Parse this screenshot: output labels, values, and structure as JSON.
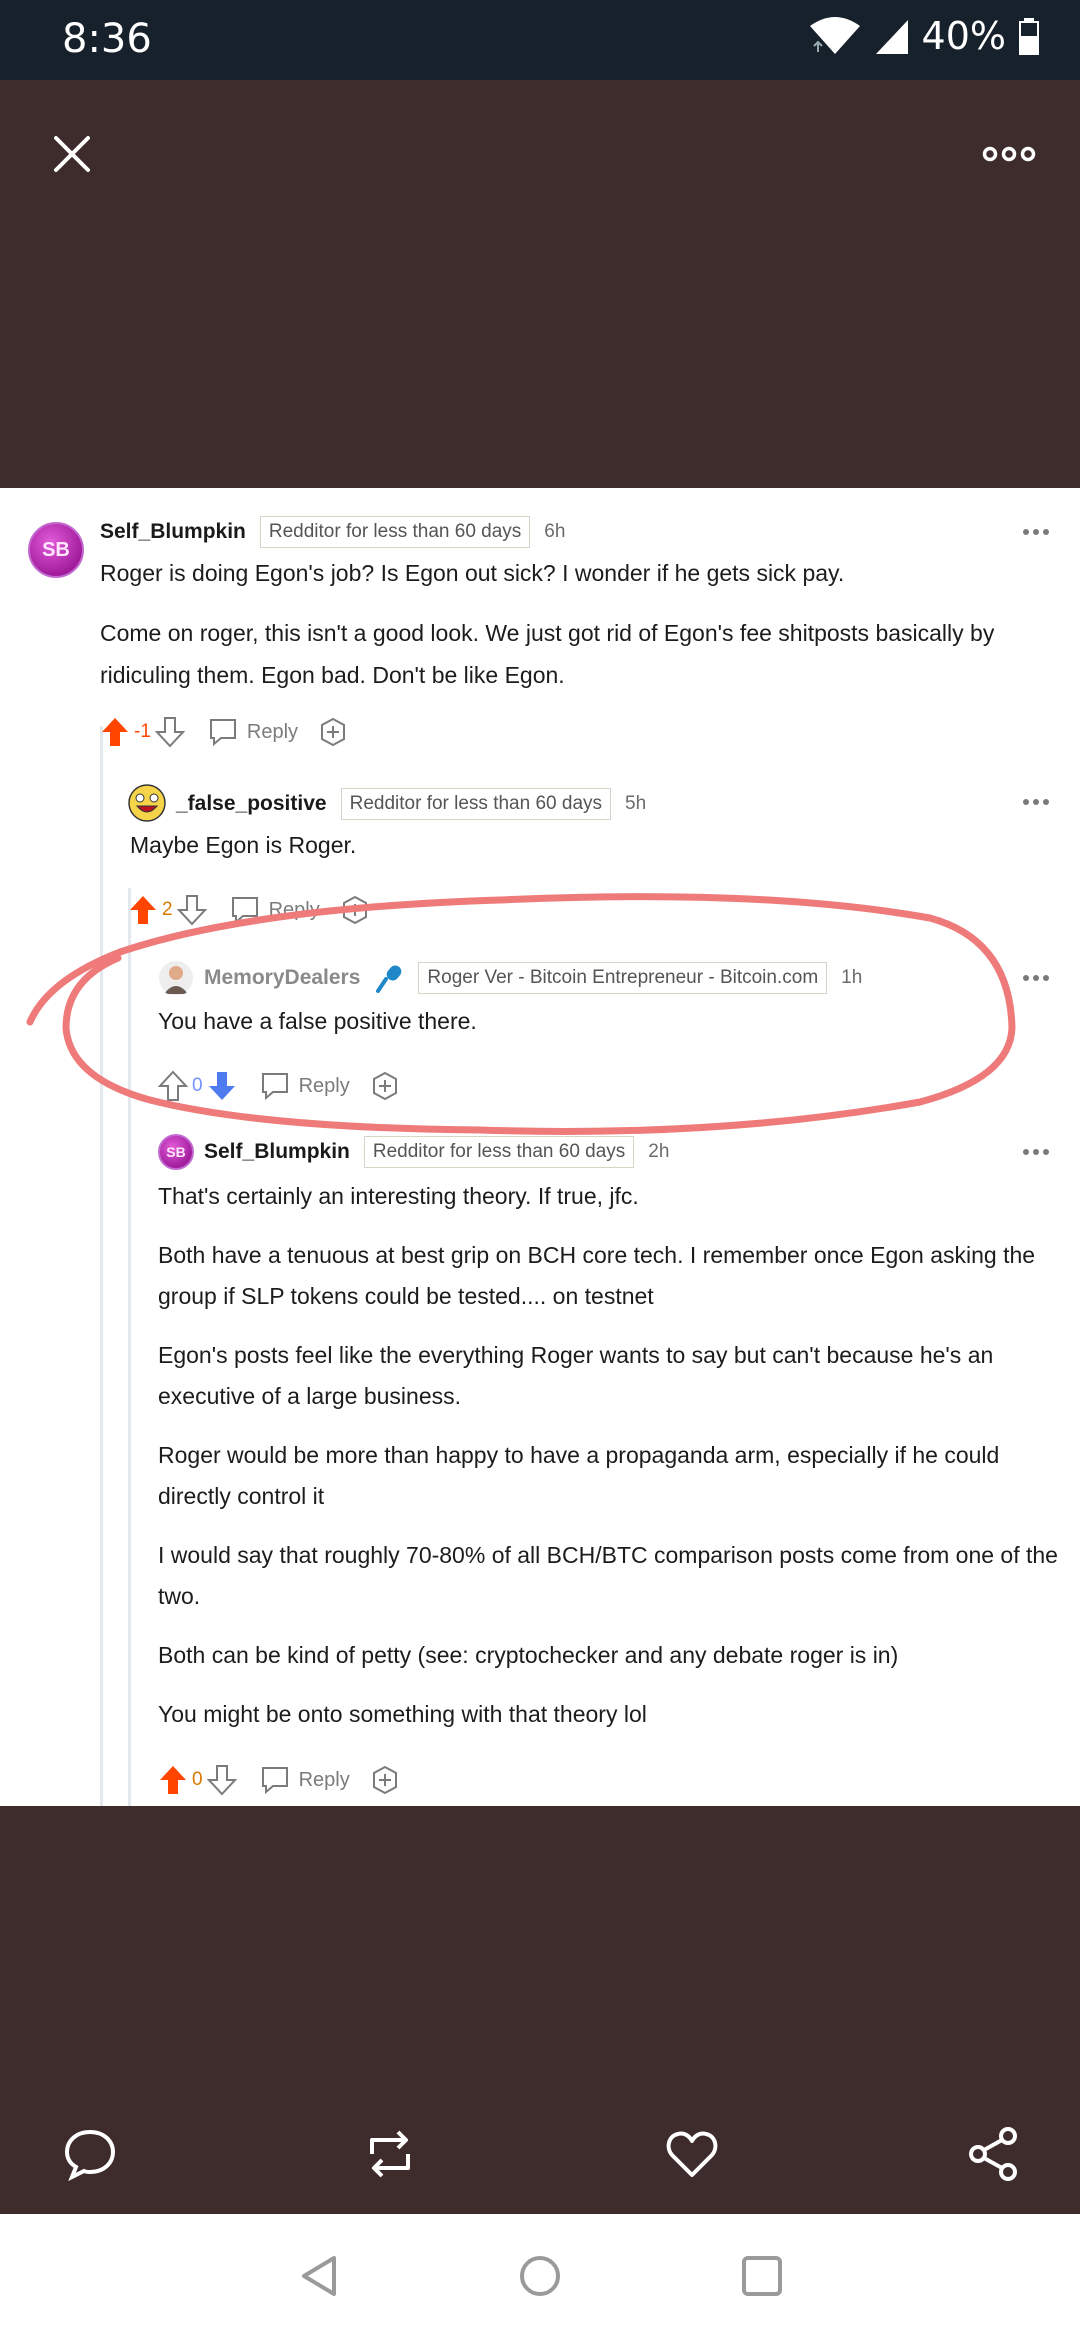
{
  "status_bar": {
    "time": "8:36",
    "battery": "40%"
  },
  "comments": [
    {
      "username": "Self_Blumpkin",
      "avatar_text": "SB",
      "flair": "Redditor for less than 60 days",
      "age": "6h",
      "paragraphs": [
        "Roger is doing Egon's job? Is Egon out sick? I wonder if he gets sick pay.",
        "Come on roger, this isn't a good look. We just got rid of Egon's fee shitposts basically by ridiculing them. Egon bad. Don't be like Egon."
      ],
      "score": "-1",
      "reply_label": "Reply"
    },
    {
      "username": "_false_positive",
      "flair": "Redditor for less than 60 days",
      "age": "5h",
      "paragraphs": [
        "Maybe Egon is Roger."
      ],
      "score": "2",
      "reply_label": "Reply"
    },
    {
      "username": "MemoryDealers",
      "flair": "Roger Ver - Bitcoin Entrepreneur - Bitcoin.com",
      "age": "1h",
      "paragraphs": [
        "You have a false positive there."
      ],
      "score": "0",
      "reply_label": "Reply"
    },
    {
      "username": "Self_Blumpkin",
      "avatar_text": "SB",
      "flair": "Redditor for less than 60 days",
      "age": "2h",
      "paragraphs": [
        "That's certainly an interesting theory. If true, jfc.",
        "Both have a tenuous at best grip on BCH core tech. I remember once Egon asking the group if SLP tokens could be tested.... on testnet",
        "Egon's posts feel like the everything Roger wants to say but can't because he's an executive of a large business.",
        "Roger would be more than happy to have a propaganda arm, especially if he could directly control it",
        "I would say that roughly 70-80% of all BCH/BTC comparison posts come from one of the two.",
        "Both can be kind of petty (see: cryptochecker and any debate roger is in)",
        "You might be onto something with that theory lol"
      ],
      "score": "0",
      "reply_label": "Reply"
    }
  ],
  "colors": {
    "upvote": "#ff4500",
    "downvote": "#7193ff",
    "annotation": "#ee7a7a",
    "background": "#3e2b2b"
  }
}
